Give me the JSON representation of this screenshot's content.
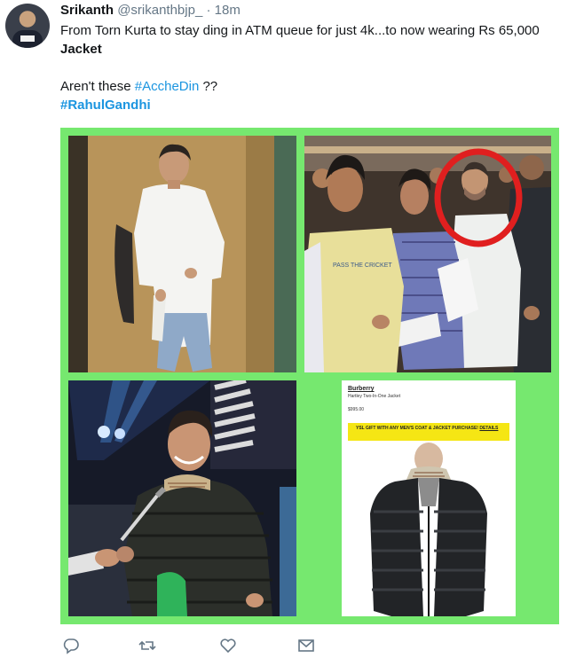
{
  "tweet": {
    "author_name": "Srikanth",
    "author_handle": "@srikanthbjp_",
    "separator": "·",
    "time": "18m",
    "line1": "From Torn Kurta to stay ding in ATM queue for just 4k...to now wearing Rs 65,000",
    "line2": "Jacket",
    "line3_text": "Aren't these ",
    "line3_hashtag": "#AccheDin",
    "line3_end": " ??",
    "line4_hashtag": "#RahulGandhi"
  },
  "media": {
    "product": {
      "brand": "Burberry",
      "name": "Hartley Two-In-One Jacket",
      "price": "$995.00",
      "promo_text": "YSL GIFT WITH ANY MEN'S COAT & JACKET PURCHASE!",
      "promo_link": "DETAILS"
    },
    "tile2_shirt_text": "PASS THE CRICKET"
  },
  "actions": [
    "reply-icon",
    "retweet-icon",
    "like-icon",
    "message-icon"
  ],
  "colors": {
    "hashtag": "#1b95e0",
    "media_border": "#76e86f",
    "highlight_circle": "#e01f1f",
    "promo_bg": "#f5e614"
  }
}
